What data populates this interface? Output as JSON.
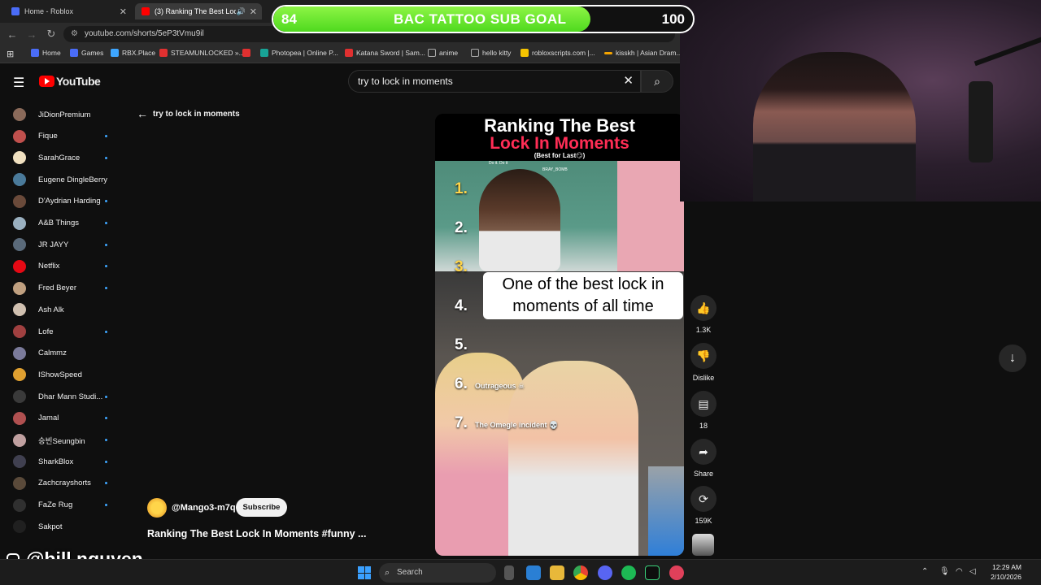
{
  "browser": {
    "tabs": [
      {
        "label": "Home - Roblox",
        "color": "#4a6cf7"
      },
      {
        "label": "(3) Ranking The Best Lock I",
        "color": "#ff0000"
      }
    ],
    "url": "youtube.com/shorts/5eP3tVmu9il",
    "bookmarks": [
      {
        "label": "Home",
        "color": "#4a6cf7"
      },
      {
        "label": "Games",
        "color": "#4a6cf7"
      },
      {
        "label": "RBX.Place",
        "color": "#3ea6ff"
      },
      {
        "label": "STEAMUNLOCKED »...",
        "color": "#e03030"
      },
      {
        "label": "Photopea | Online P...",
        "color": "#18a497"
      },
      {
        "label": "Katana Sword | Sam...",
        "color": "#e03030"
      },
      {
        "label": "anime",
        "color": "#888888"
      },
      {
        "label": "hello kitty",
        "color": "#888888"
      },
      {
        "label": "robloxscripts.com |...",
        "color": "#f5c400"
      },
      {
        "label": "kisskh | Asian Dram...",
        "color": "#f5a400"
      }
    ]
  },
  "goal": {
    "current": "84",
    "title": "BAC TATTOO SUB GOAL",
    "max": "100",
    "progress": 0.84
  },
  "youtube": {
    "logo": "YouTube",
    "search_value": "try to lock in moments",
    "back_label": "try to lock in moments"
  },
  "sidebar": {
    "items": [
      {
        "label": "JiDionPremium",
        "color": "#8a6a5a",
        "dot": false
      },
      {
        "label": "Fique",
        "color": "#c0504d",
        "dot": true
      },
      {
        "label": "SarahGrace",
        "color": "#f0e0c0",
        "dot": true
      },
      {
        "label": "Eugene DingleBerry",
        "color": "#4a7a9a",
        "dot": false
      },
      {
        "label": "D'Aydrian Harding",
        "color": "#6a4a3a",
        "dot": true
      },
      {
        "label": "A&B Things",
        "color": "#9ab0c0",
        "dot": true
      },
      {
        "label": "JR JAYY",
        "color": "#5a6a7a",
        "dot": true
      },
      {
        "label": "Netflix",
        "color": "#e50914",
        "dot": true
      },
      {
        "label": "Fred Beyer",
        "color": "#c0a080",
        "dot": true
      },
      {
        "label": "Ash Alk",
        "color": "#d0c0b0",
        "dot": false
      },
      {
        "label": "Lofe",
        "color": "#a04040",
        "dot": true
      },
      {
        "label": "Calmmz",
        "color": "#7a7a9a",
        "dot": false
      },
      {
        "label": "IShowSpeed",
        "color": "#e0a030",
        "dot": false
      },
      {
        "label": "Dhar Mann Studi...",
        "color": "#3a3a3a",
        "dot": true
      },
      {
        "label": "Jamal",
        "color": "#b05050",
        "dot": true
      },
      {
        "label": "승빈Seungbin",
        "color": "#c0a0a0",
        "dot": true
      },
      {
        "label": "SharkBlox",
        "color": "#404050",
        "dot": true
      },
      {
        "label": "Zachcrayshorts",
        "color": "#5a4a3a",
        "dot": true
      },
      {
        "label": "FaZe Rug",
        "color": "#303030",
        "dot": true
      },
      {
        "label": "Sakpot",
        "color": "#202020",
        "dot": false
      }
    ]
  },
  "video": {
    "title_line1": "Ranking The Best",
    "title_line2": "Lock In Moments",
    "title_line3": "(Best for Last😏)",
    "ranks": [
      "1.",
      "2.",
      "3.",
      "4.",
      "5.",
      "6.",
      "7."
    ],
    "rank6_label": "Outrageous ☠",
    "rank7_label": "The Omegle incident 💀",
    "caption": "One of the best lock in moments of all time",
    "watermark1": "Do it. Do it",
    "watermark2": "BRAY_BOMB"
  },
  "actions": {
    "likes": "1.3K",
    "dislike": "Dislike",
    "comments": "18",
    "share": "Share",
    "remix": "159K"
  },
  "channel": {
    "name": "@Mango3-m7q",
    "subscribe": "Subscribe"
  },
  "video_title": "Ranking The Best Lock In Moments #funny ...",
  "overlay_handle": "@bill.nguyen",
  "taskbar": {
    "search": "Search",
    "time": "12:29 AM",
    "date": "2/10/2026"
  }
}
